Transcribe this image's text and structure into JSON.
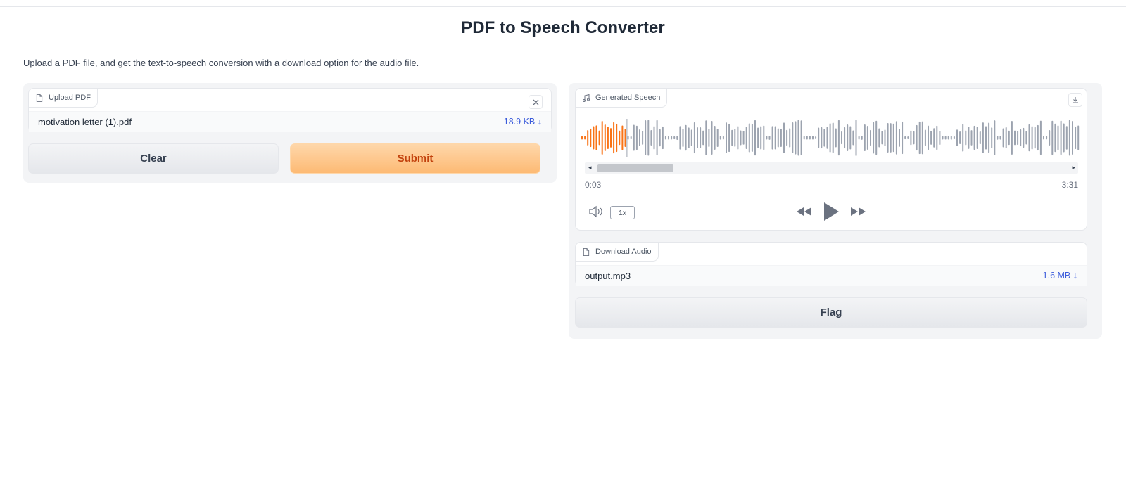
{
  "header": {
    "title": "PDF to Speech Converter",
    "description": "Upload a PDF file, and get the text-to-speech conversion with a download option for the audio file."
  },
  "upload": {
    "label": "Upload PDF",
    "file_name": "motivation letter (1).pdf",
    "file_size": "18.9 KB ↓",
    "clear_icon": "close-icon"
  },
  "buttons": {
    "clear": "Clear",
    "submit": "Submit",
    "flag": "Flag"
  },
  "speech": {
    "label": "Generated Speech",
    "current_time": "0:03",
    "duration": "3:31",
    "playback_rate": "1x",
    "played_fraction": 0.09,
    "icons": [
      "music-note-icon",
      "download-icon",
      "volume-icon",
      "rewind-icon",
      "play-icon",
      "fast-forward-icon"
    ]
  },
  "download": {
    "label": "Download Audio",
    "file_name": "output.mp3",
    "file_size": "1.6 MB ↓"
  },
  "colors": {
    "accent": "#f97316",
    "link": "#3b5bdb",
    "waveform_unplayed": "#9ca3af",
    "waveform_played": "#f97316"
  }
}
